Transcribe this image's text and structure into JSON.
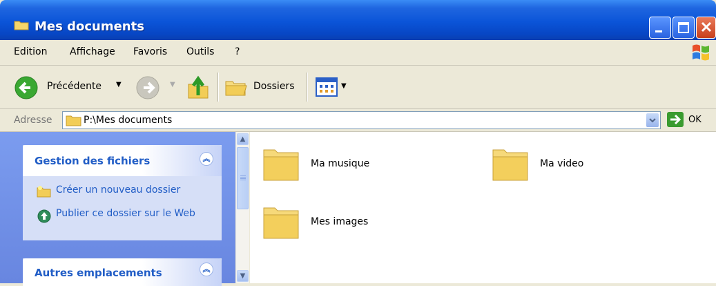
{
  "window": {
    "title": "Mes documents"
  },
  "menu": {
    "items": [
      "Edition",
      "Affichage",
      "Favoris",
      "Outils",
      "?"
    ]
  },
  "toolbar": {
    "back_label": "Précédente",
    "folders_label": "Dossiers"
  },
  "address": {
    "label": "Adresse",
    "value": "P:\\Mes documents",
    "go_label": "OK"
  },
  "tasks": {
    "file_management": {
      "title": "Gestion des fichiers",
      "items": [
        "Créer un nouveau dossier",
        "Publier ce dossier sur le Web"
      ]
    },
    "other_places": {
      "title": "Autres emplacements"
    }
  },
  "folders": [
    "Ma musique",
    "Ma video",
    "Mes images"
  ],
  "colors": {
    "title_bar": "#0b54d8",
    "task_link": "#215dc6",
    "left_panel": "#7b9cef"
  }
}
